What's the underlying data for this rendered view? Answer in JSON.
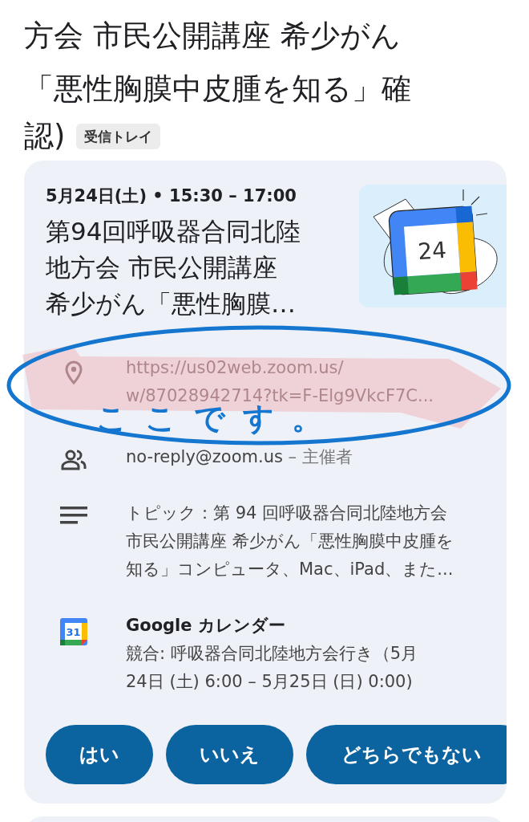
{
  "subject": {
    "lines": [
      "方会 市民公開講座 希少がん",
      "「悪性胸膜中皮腫を知る」確",
      "認)"
    ],
    "label": "受信トレイ"
  },
  "event": {
    "when": "5月24日(土) • 15:30 – 17:00",
    "title_lines": [
      "第94回呼吸器合同北陸",
      "地方会 市民公開講座",
      "希少がん「悪性胸膜…"
    ],
    "image": {
      "day": "24"
    },
    "rows": [
      {
        "kind": "location",
        "lines": [
          "https://us02web.zoom.us/",
          "w/87028942714?tk=F-Elg9VkcF7C..."
        ]
      },
      {
        "kind": "organizer",
        "email": "no-reply@zoom.us",
        "role": "– 主催者"
      },
      {
        "kind": "description",
        "lines": [
          "トピック：第 94 回呼吸器合同北陸地方会",
          "市民公開講座 希少がん「悪性胸膜中皮腫を",
          "知る」コンピュータ、Mac、iPad、また..."
        ]
      },
      {
        "kind": "calendar",
        "title": "Google カレンダー",
        "icon_day": "31",
        "lines": [
          "競合: 呼吸器合同北陸地方会行き（5月",
          "24日 (土) 6:00 – 5月25日 (日) 0:00)"
        ]
      }
    ],
    "buttons": [
      "はい",
      "いいえ",
      "どちらでもない"
    ]
  },
  "annotation": {
    "text": "ここです。"
  }
}
